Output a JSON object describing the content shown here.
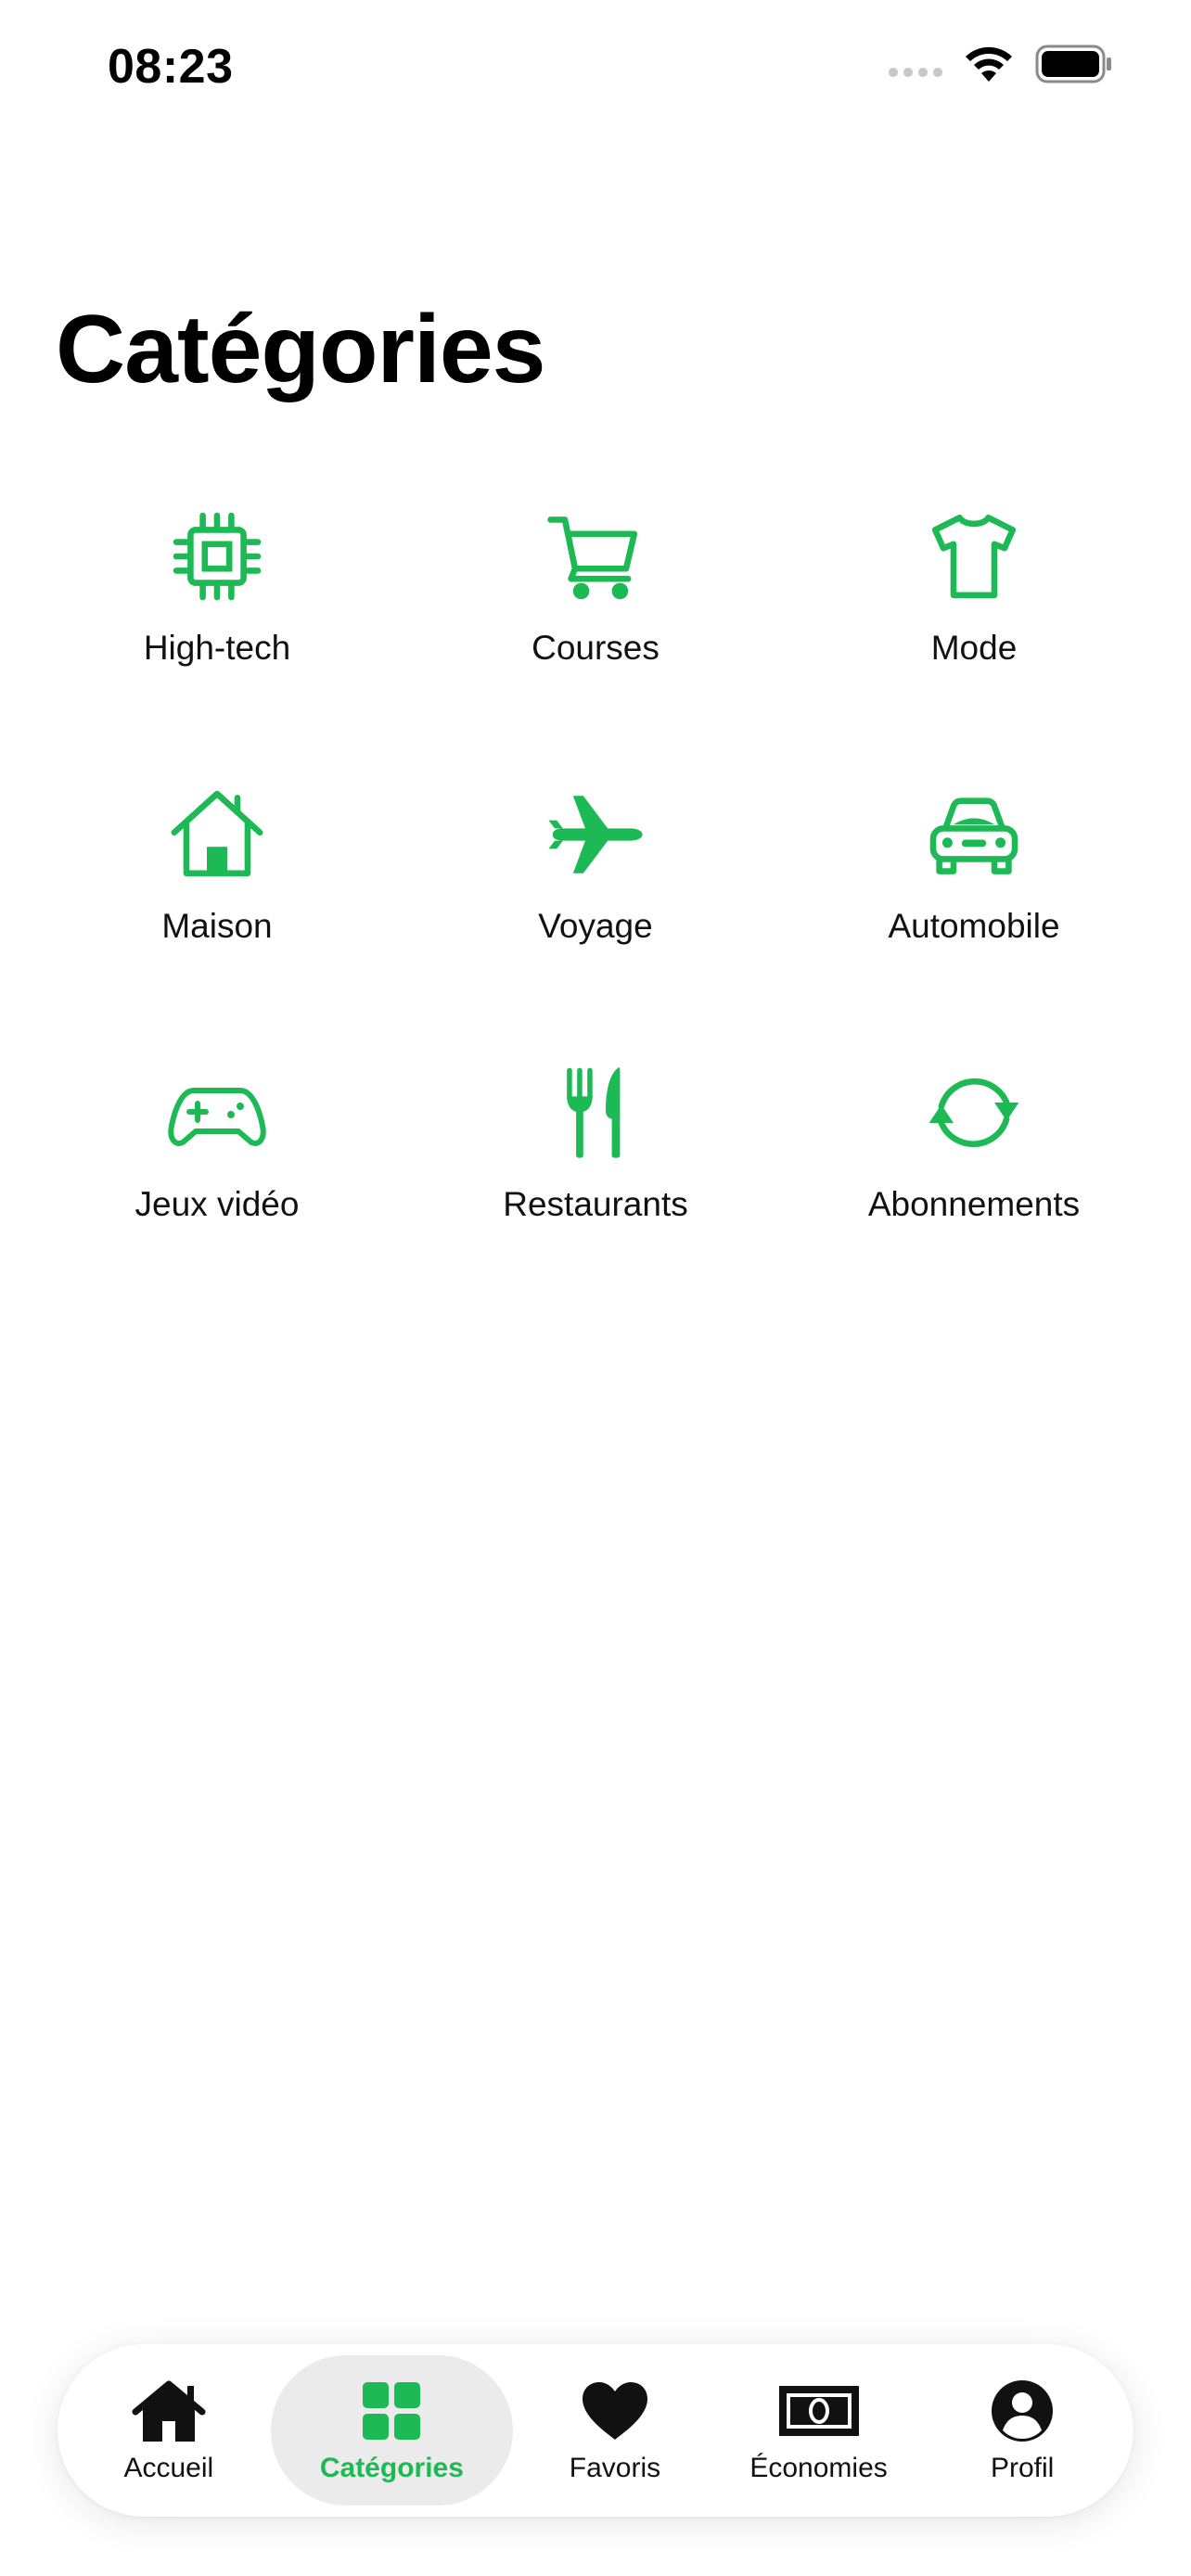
{
  "status": {
    "time": "08:23"
  },
  "page": {
    "title": "Catégories"
  },
  "colors": {
    "accent": "#1DB954",
    "tab_active_bg": "#EBEBEB"
  },
  "categories": [
    {
      "label": "High-tech",
      "icon": "cpu-icon"
    },
    {
      "label": "Courses",
      "icon": "cart-icon"
    },
    {
      "label": "Mode",
      "icon": "tshirt-icon"
    },
    {
      "label": "Maison",
      "icon": "house-icon"
    },
    {
      "label": "Voyage",
      "icon": "airplane-icon"
    },
    {
      "label": "Automobile",
      "icon": "car-icon"
    },
    {
      "label": "Jeux vidéo",
      "icon": "gamepad-icon"
    },
    {
      "label": "Restaurants",
      "icon": "fork-knife-icon"
    },
    {
      "label": "Abonnements",
      "icon": "refresh-icon"
    }
  ],
  "tabbar": {
    "items": [
      {
        "label": "Accueil",
        "icon": "home-icon",
        "active": false
      },
      {
        "label": "Catégories",
        "icon": "grid-icon",
        "active": true
      },
      {
        "label": "Favoris",
        "icon": "heart-icon",
        "active": false
      },
      {
        "label": "Économies",
        "icon": "banknote-icon",
        "active": false
      },
      {
        "label": "Profil",
        "icon": "person-circle-icon",
        "active": false
      }
    ]
  }
}
